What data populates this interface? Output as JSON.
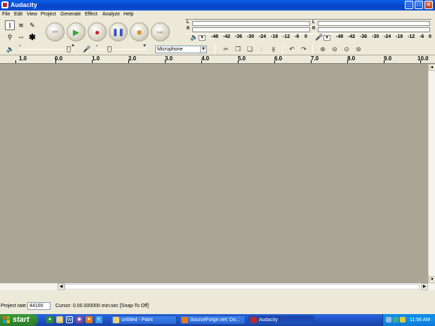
{
  "window": {
    "title": "Audacity"
  },
  "menu": [
    "File",
    "Edit",
    "View",
    "Project",
    "Generate",
    "Effect",
    "Analyze",
    "Help"
  ],
  "meters": {
    "channel_l": "L",
    "channel_r": "R",
    "scale": [
      "-48",
      "-42",
      "-36",
      "-30",
      "-24",
      "-18",
      "-12",
      "-6",
      "0"
    ]
  },
  "mixer": {
    "input_source": "Microphone",
    "output_scale_min": "-",
    "output_scale_max": "+",
    "input_scale_min": "-",
    "input_scale_max": "+"
  },
  "ruler": {
    "labels": [
      "1.0",
      "0.0",
      "1.0",
      "2.0",
      "3.0",
      "4.0",
      "5.0",
      "6.0",
      "7.0",
      "8.0",
      "9.0",
      "10.0"
    ]
  },
  "status": {
    "rate_label": "Project rate:",
    "rate_value": "44100",
    "cursor": "Cursor: 0.00.000000 min:sec  [Snap-To Off]"
  },
  "taskbar": {
    "start_label": "start",
    "tasks": [
      {
        "label": "untitled - Paint"
      },
      {
        "label": "SourceForge.net: Do..."
      },
      {
        "label": "Audacity"
      }
    ],
    "clock": "11:56 AM"
  },
  "colors": {
    "title_blue": "#0841C4",
    "track_bg": "#A9A695",
    "start_green": "#318a31",
    "taskbar_blue": "#245edb"
  }
}
